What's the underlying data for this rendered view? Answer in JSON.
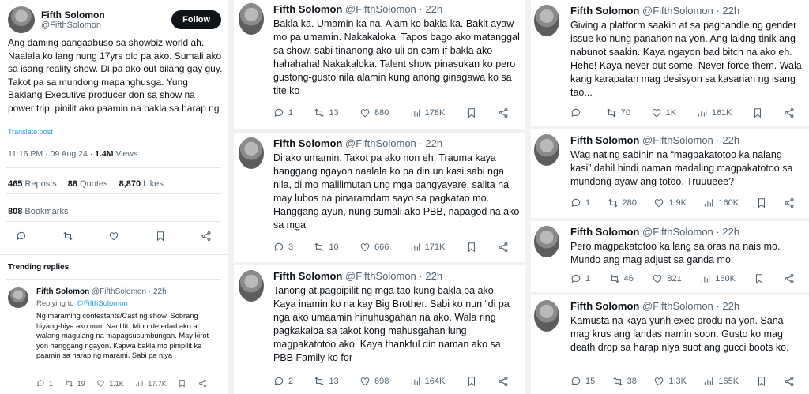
{
  "author": {
    "name": "Fifth Solomon",
    "handle": "@FifthSolomon",
    "time": "22h"
  },
  "main": {
    "follow_label": "Follow",
    "text": "Ang daming pangaabuso sa showbiz world ah. Naalala ko lang nung 17yrs old pa ako. Sumali ako sa isang reality show. Di pa ako out bilang gay guy. Takot pa sa mundong mapanghusga. Yung Baklang Executive producer don sa show na power trip, pinilit ako paamin na bakla sa harap ng",
    "translate": "Translate post",
    "timestamp": "11:16 PM · 09 Aug 24 · ",
    "views_count": "1.4M",
    "views_label": "Views",
    "reposts_count": "465",
    "reposts_label": "Reposts",
    "quotes_count": "88",
    "quotes_label": "Quotes",
    "likes_count": "8,870",
    "likes_label": "Likes",
    "bookmarks_count": "808",
    "bookmarks_label": "Bookmarks"
  },
  "trending": {
    "heading": "Trending replies",
    "reply": {
      "replying_prefix": "Replying to ",
      "replying_handle": "@FifthSolomon",
      "text": "Ng maraming contestants/Cast ng show. Sobrang hiyang-hiya ako nun. Nanlilit. Minorde edad ako at walang magulang na mapagsusumbungan. May kirot yon hanggang ngayon. Kapwa bakla mo pinipilit ka paamin sa harap ng marami. Sabi pa niya",
      "replies": "1",
      "reposts": "19",
      "likes": "1.1K",
      "views": "17.7K"
    }
  },
  "threads_mid": [
    {
      "text": "Bakla ka. Umamin ka na. Alam ko bakla ka. Bakit ayaw mo pa umamin. Nakakaloka. Tapos bago ako matanggal sa show, sabi tinanong ako uli on cam if bakla ako hahahaha! Nakakaloka. Talent show pinasukan ko pero gustong-gusto nila alamin kung anong ginagawa ko sa tite ko",
      "replies": "1",
      "reposts": "13",
      "likes": "880",
      "views": "178K"
    },
    {
      "text": "Di ako umamin. Takot pa ako non eh. Trauma kaya hanggang ngayon naalala ko pa din un kasi sabi nga nila, di mo malilimutan ung mga pangyayare, salita na may lubos na pinaramdam sayo sa pagkatao mo. Hanggang ayun, nung sumali ako PBB, napagod na ako sa mga",
      "replies": "3",
      "reposts": "10",
      "likes": "666",
      "views": "171K"
    },
    {
      "text": "Tanong at pagpipilit ng mga tao kung bakla ba ako. Kaya inamin ko na kay Big Brother. Sabi ko nun “di pa nga ako umaamin hinuhusgahan na ako. Wala ring pagkakaiba sa takot kong mahusgahan lung magpakatotoo ako. Kaya thankful din naman ako sa PBB Family ko for",
      "replies": "2",
      "reposts": "13",
      "likes": "698",
      "views": "164K"
    }
  ],
  "threads_right": [
    {
      "text": "Giving a platform saakin at sa paghandle ng gender issue ko nung panahon na yon. Ang laking tinik ang nabunot saakin. Kaya ngayon bad bitch na ako eh. Hehe! Kaya never out some. Never force them. Wala kang karapatan mag desisyon sa kasarian ng isang tao...",
      "replies": "",
      "reposts": "70",
      "likes": "1K",
      "views": "161K"
    },
    {
      "text": "Wag nating sabihin na “magpakatotoo ka nalang kasi” dahil hindi naman madaling magpakatotoo sa mundong ayaw ang totoo. Truuueee?",
      "replies": "1",
      "reposts": "280",
      "likes": "1.9K",
      "views": "160K"
    },
    {
      "text": "Pero magpakatotoo ka lang sa oras na nais mo. Mundo ang mag adjust sa ganda mo.",
      "replies": "1",
      "reposts": "46",
      "likes": "821",
      "views": "160K"
    },
    {
      "text": "Kamusta na kaya yunh exec produ na yon. Sana mag krus ang landas namin soon. Gusto ko mag death drop sa harap niya suot ang gucci boots ko.",
      "replies": "15",
      "reposts": "38",
      "likes": "1.3K",
      "views": "165K"
    }
  ]
}
